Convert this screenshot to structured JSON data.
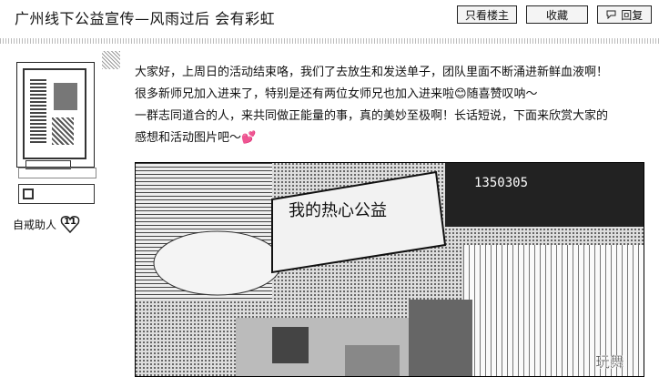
{
  "header": {
    "title": "广州线下公益宣传—风雨过后 会有彩虹",
    "buttons": {
      "owner_only": "只看楼主",
      "favorite": "收藏",
      "reply": "回复"
    }
  },
  "sidebar": {
    "medal_label": "自戒助人",
    "medal_count": "11"
  },
  "post": {
    "paragraphs": [
      "大家好，上周日的活动结束咯，我们了去放生和发送单子，团队里面不断涌进新鲜血液啊！",
      "很多新师兄加入进来了，特别是还有两位女师兄也加入进来啦😊随喜赞叹呐～",
      "一群志同道合的人，来共同做正能量的事，真的美妙至极啊！长话短说，下面来欣赏大家的",
      "感想和活动图片吧～💕"
    ],
    "image": {
      "sign_text": "我的热心公益",
      "number_text": "1350305",
      "corner_text": "玩舞"
    }
  },
  "colors": {
    "text": "#111111",
    "border": "#222222",
    "background": "#ffffff"
  }
}
